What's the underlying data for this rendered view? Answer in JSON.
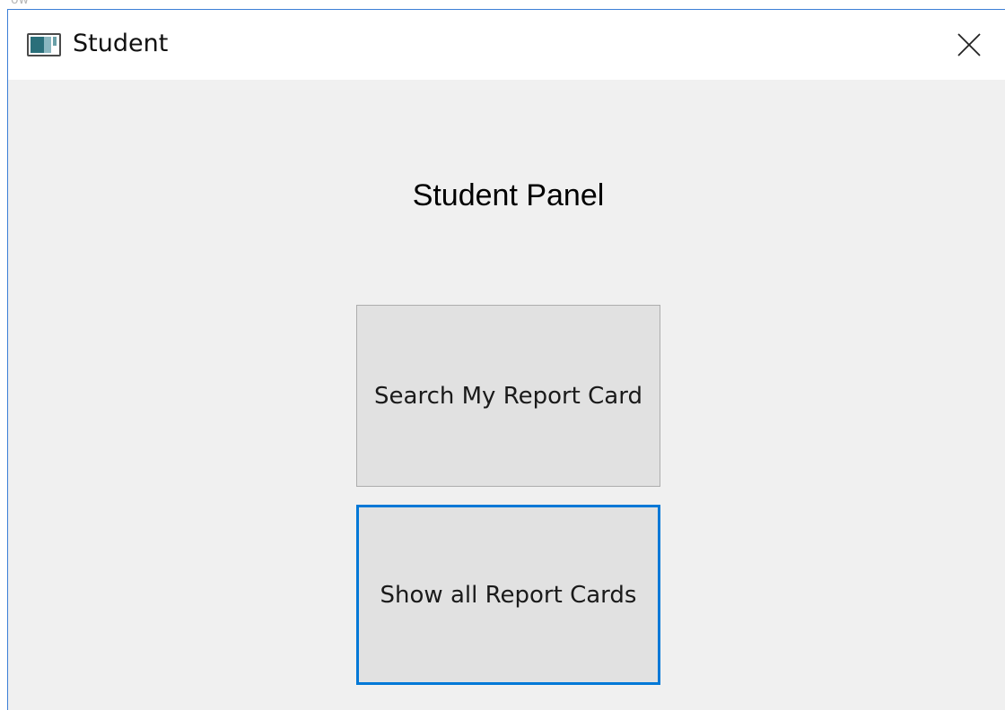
{
  "window": {
    "title": "Student",
    "app_icon": "window-app-icon",
    "close_icon": "close-icon"
  },
  "panel": {
    "heading": "Student Panel",
    "buttons": {
      "search_label": "Search My Report Card",
      "show_all_label": "Show all Report Cards"
    }
  },
  "colors": {
    "window_bg": "#f0f0f0",
    "titlebar_bg": "#ffffff",
    "button_bg": "#e1e1e1",
    "focus_border": "#0078d7"
  }
}
